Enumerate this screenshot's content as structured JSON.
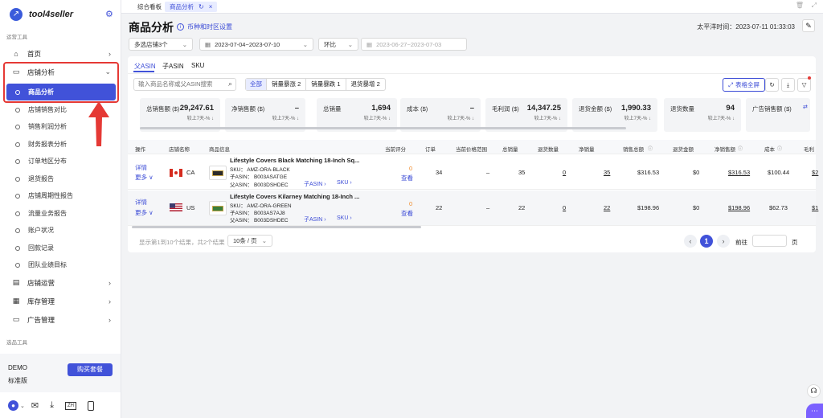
{
  "sidebar": {
    "brand": "tool4seller",
    "section_ops": "运营工具",
    "section_selection": "选品工具",
    "items": [
      {
        "label": "首页"
      },
      {
        "label": "店铺分析"
      },
      {
        "label": "店铺运营"
      },
      {
        "label": "库存管理"
      },
      {
        "label": "广告管理"
      }
    ],
    "sub_items": [
      {
        "label": "商品分析"
      },
      {
        "label": "店铺销售对比"
      },
      {
        "label": "销售利润分析"
      },
      {
        "label": "财务报表分析"
      },
      {
        "label": "订单地区分布"
      },
      {
        "label": "退货报告"
      },
      {
        "label": "店铺周期性报告"
      },
      {
        "label": "流量业务报告"
      },
      {
        "label": "账户状况"
      },
      {
        "label": "回款记录"
      },
      {
        "label": "团队业绩目标"
      }
    ],
    "account": {
      "name": "DEMO",
      "plan": "标准版",
      "buy_label": "购买套餐"
    },
    "bottom_icons": [
      "user-icon",
      "mail-icon",
      "download-icon",
      "language-icon",
      "mobile-icon"
    ],
    "lang_badge": "ZH"
  },
  "tabs": [
    {
      "label": "综合看板"
    },
    {
      "label": "商品分析"
    }
  ],
  "header": {
    "title": "商品分析",
    "currency_link": "币种和时区设置",
    "time_label": "太平洋时间：2023-07-11 01:33:03"
  },
  "filters": {
    "store": "多选店铺3个",
    "date_range": "2023-07-04~2023-07-10",
    "compare": "环比",
    "compare_range": "2023-06-27~2023-07-03"
  },
  "subtabs": [
    "父ASIN",
    "子ASIN",
    "SKU"
  ],
  "search": {
    "placeholder": "输入商品名称或父ASIN搜索"
  },
  "segments": [
    "全部",
    "销量暴涨 2",
    "销量暴跌 1",
    "退货暴增 2"
  ],
  "fullscreen_label": "表格全屏",
  "stats": [
    {
      "label": "总销售额 ($)",
      "value": "29,247.61",
      "sub": "较上7天-% ↓"
    },
    {
      "label": "净销售额 ($)",
      "value": "–",
      "sub": "较上7天-% ↓"
    },
    {
      "label": "总销量",
      "value": "1,694",
      "sub": "较上7天-% ↓"
    },
    {
      "label": "成本 ($)",
      "value": "–",
      "sub": "较上7天-% ↓"
    },
    {
      "label": "毛利润 ($)",
      "value": "14,347.25",
      "sub": "较上7天-% ↓"
    },
    {
      "label": "退货金额 ($)",
      "value": "1,990.33",
      "sub": "较上7天-% ↓"
    },
    {
      "label": "退货数量",
      "value": "94",
      "sub": "较上7天-% ↓"
    },
    {
      "label": "广告销售额 ($)",
      "value": "",
      "sub": ""
    }
  ],
  "table": {
    "headers": [
      "操作",
      "店铺名称",
      "商品信息",
      "当前评分",
      "订单",
      "当前价格范围",
      "总销量",
      "退货数量",
      "净销量",
      "销售总额",
      "退货金额",
      "净销售额",
      "成本",
      "毛利"
    ],
    "rows": [
      {
        "action1": "详情",
        "action2": "更多 ∨",
        "country": "CA",
        "title": "Lifestyle Covers Black Matching 18-Inch Sq...",
        "sku": "SKU：  AMZ-ORA-BLACK",
        "child_asin": "子ASIN：  B003ASATGE",
        "parent_asin": "父ASIN：  B003DSHDEC",
        "child_link": "子ASIN ›",
        "sku_link": "SKU ›",
        "rating": "0",
        "rating_link": "查看",
        "orders": "34",
        "price_range": "–",
        "total_sales": "35",
        "returns": "0",
        "net_qty": "35",
        "gross": "$316.53",
        "refund": "$0",
        "net_sales": "$316.53",
        "cost": "$100.44",
        "profit": "$2"
      },
      {
        "action1": "详情",
        "action2": "更多 ∨",
        "country": "US",
        "title": "Lifestyle Covers Kilarney Matching 18-Inch ...",
        "sku": "SKU：  AMZ-ORA-GREEN",
        "child_asin": "子ASIN：  B003AS7AJ8",
        "parent_asin": "父ASIN：  B003DSHDEC",
        "child_link": "子ASIN ›",
        "sku_link": "SKU ›",
        "rating": "0",
        "rating_link": "查看",
        "orders": "22",
        "price_range": "–",
        "total_sales": "22",
        "returns": "0",
        "net_qty": "22",
        "gross": "$198.96",
        "refund": "$0",
        "net_sales": "$198.96",
        "cost": "$62.73",
        "profit": "$1"
      }
    ]
  },
  "pager": {
    "summary": "显示第1到10个结果，共2个结果",
    "page_size": "10条 / 页",
    "current": "1",
    "goto_label": "前往",
    "page_unit": "页"
  },
  "colors": {
    "accent": "#4152d9",
    "highlight_box": "#e53935",
    "arrow": "#e53935"
  }
}
